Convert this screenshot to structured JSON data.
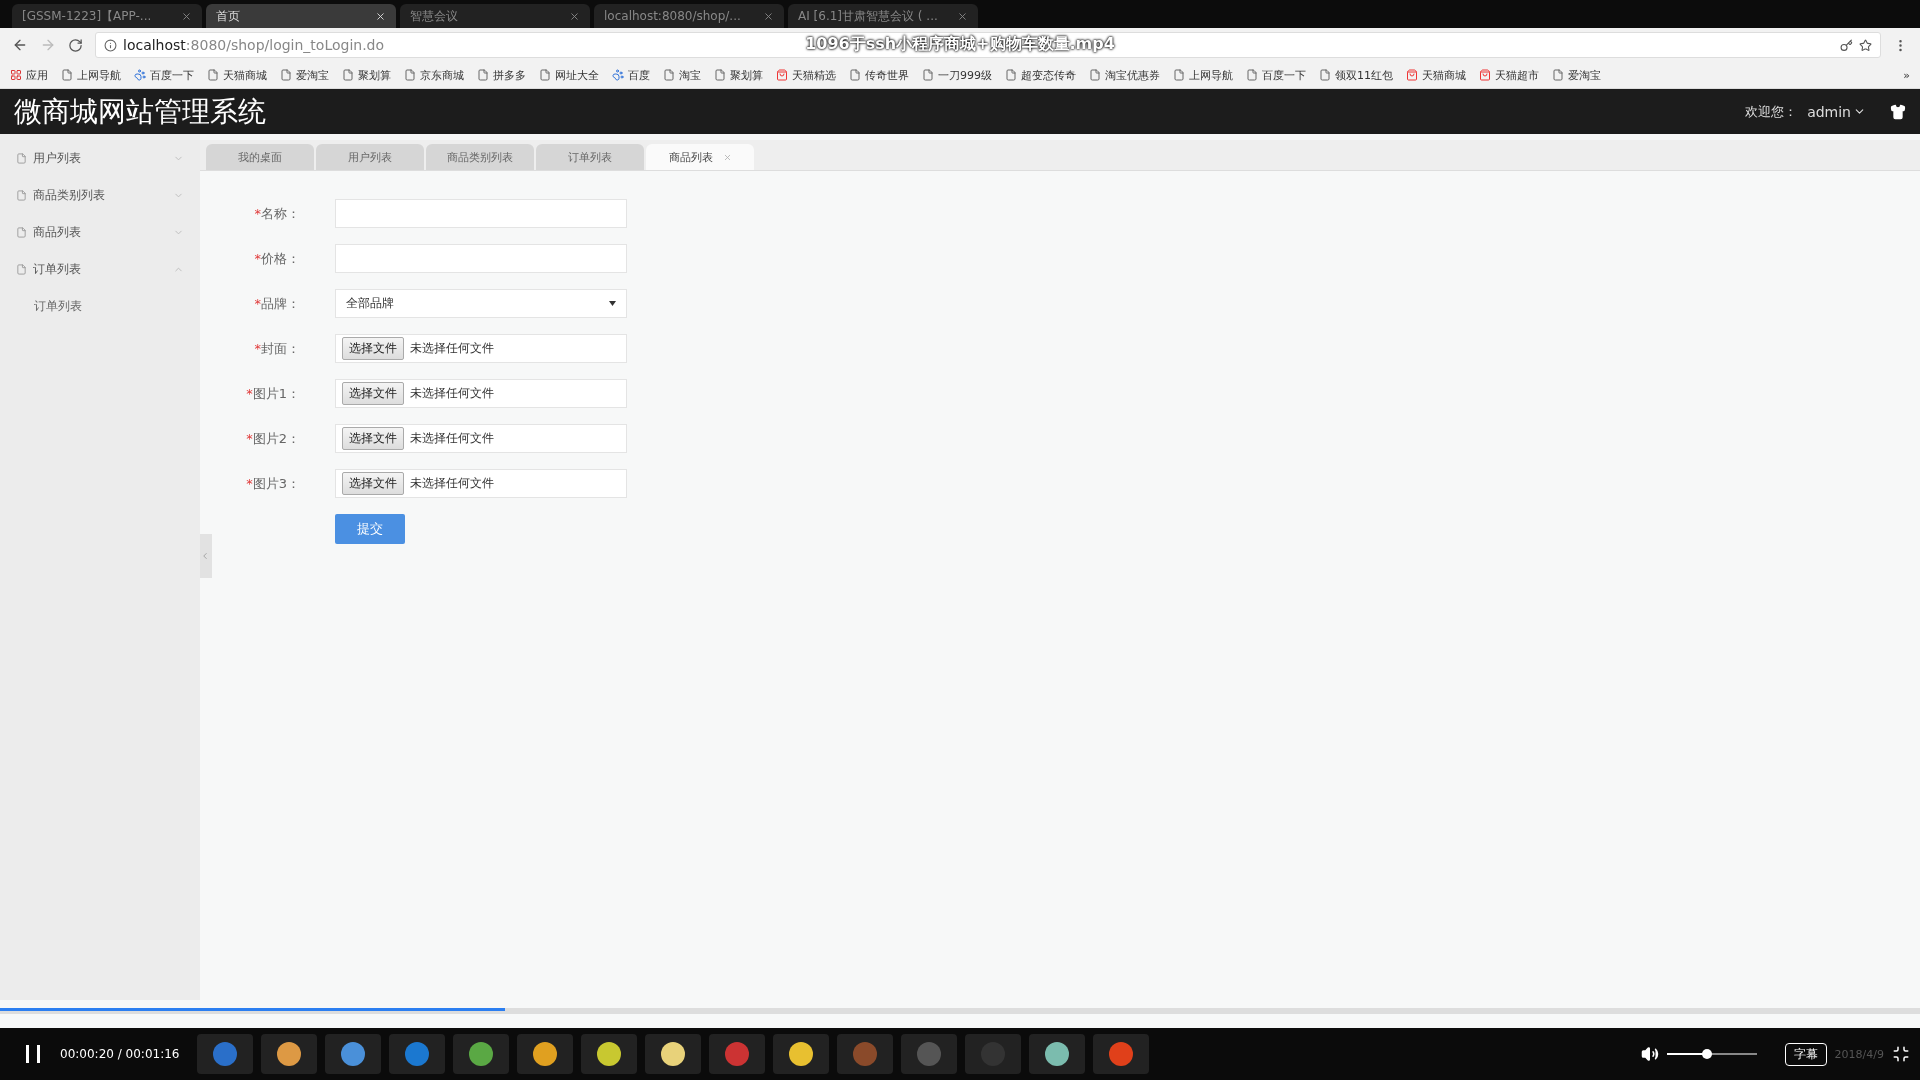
{
  "browser": {
    "tabs": [
      {
        "title": "[GSSM-1223]【APP-...",
        "selected": false
      },
      {
        "title": "首页",
        "selected": true
      },
      {
        "title": "智慧会议",
        "selected": false
      },
      {
        "title": "localhost:8080/shop/...",
        "selected": false
      },
      {
        "title": "AI [6.1]甘肃智慧会议 ( ...",
        "selected": false
      }
    ],
    "url_host": "localhost",
    "url_rest": ":8080/shop/login_toLogin.do",
    "bookmarks": [
      {
        "kind": "apps",
        "label": "应用"
      },
      {
        "kind": "page",
        "label": "上网导航"
      },
      {
        "kind": "paw",
        "label": "百度一下"
      },
      {
        "kind": "page",
        "label": "天猫商城"
      },
      {
        "kind": "page",
        "label": "爱淘宝"
      },
      {
        "kind": "page",
        "label": "聚划算"
      },
      {
        "kind": "page",
        "label": "京东商城"
      },
      {
        "kind": "page",
        "label": "拼多多"
      },
      {
        "kind": "page",
        "label": "网址大全"
      },
      {
        "kind": "paw",
        "label": "百度"
      },
      {
        "kind": "page",
        "label": "淘宝"
      },
      {
        "kind": "page",
        "label": "聚划算"
      },
      {
        "kind": "shop",
        "label": "天猫精选"
      },
      {
        "kind": "page",
        "label": "传奇世界"
      },
      {
        "kind": "page",
        "label": "一刀999级"
      },
      {
        "kind": "page",
        "label": "超变态传奇"
      },
      {
        "kind": "page",
        "label": "淘宝优惠券"
      },
      {
        "kind": "page",
        "label": "上网导航"
      },
      {
        "kind": "page",
        "label": "百度一下"
      },
      {
        "kind": "page",
        "label": "领双11红包"
      },
      {
        "kind": "shop",
        "label": "天猫商城"
      },
      {
        "kind": "shop",
        "label": "天猫超市"
      },
      {
        "kind": "page",
        "label": "爱淘宝"
      }
    ],
    "more": "»"
  },
  "video_title": "1096于ssh小程序商城+购物车数量.mp4",
  "app": {
    "title": "微商城网站管理系统",
    "welcome": "欢迎您：",
    "user": "admin"
  },
  "sidebar": [
    {
      "label": "用户列表",
      "expanded": false
    },
    {
      "label": "商品类别列表",
      "expanded": false
    },
    {
      "label": "商品列表",
      "expanded": false
    },
    {
      "label": "订单列表",
      "expanded": true,
      "children": [
        {
          "label": "订单列表"
        }
      ]
    }
  ],
  "tabs": [
    {
      "label": "我的桌面",
      "selected": false
    },
    {
      "label": "用户列表",
      "selected": false
    },
    {
      "label": "商品类别列表",
      "selected": false
    },
    {
      "label": "订单列表",
      "selected": false
    },
    {
      "label": "商品列表",
      "selected": true
    }
  ],
  "form": {
    "fields": [
      {
        "kind": "text",
        "required_mark": "*",
        "label": "名称："
      },
      {
        "kind": "text",
        "required_mark": "*",
        "label": "价格："
      },
      {
        "kind": "select",
        "required_mark": "*",
        "label": "品牌：",
        "value": "全部品牌"
      },
      {
        "kind": "file",
        "required_mark": "*",
        "label": "封面：",
        "button": "选择文件",
        "status": "未选择任何文件"
      },
      {
        "kind": "file",
        "required_mark": "*",
        "label": "图片1：",
        "button": "选择文件",
        "status": "未选择任何文件"
      },
      {
        "kind": "file",
        "required_mark": "*",
        "label": "图片2：",
        "button": "选择文件",
        "status": "未选择任何文件"
      },
      {
        "kind": "file",
        "required_mark": "*",
        "label": "图片3：",
        "button": "选择文件",
        "status": "未选择任何文件"
      }
    ],
    "submit": "提交"
  },
  "player": {
    "progress": {
      "level": 0.263
    },
    "time": "00:00:20 / 00:01:16",
    "volume": {
      "level": 0.45
    },
    "subtitle_button": "字幕"
  },
  "taskbar": {
    "date": "2018/4/9"
  }
}
